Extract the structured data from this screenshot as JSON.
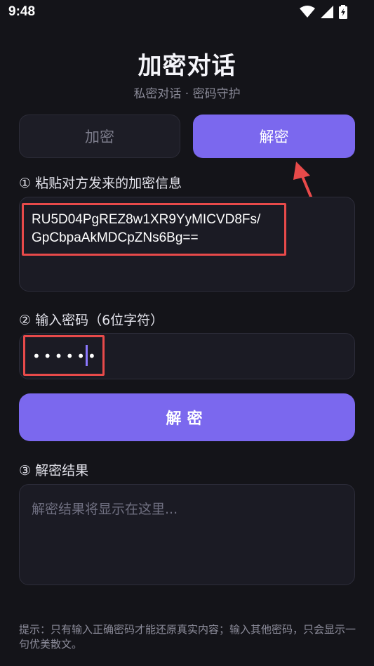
{
  "status_bar": {
    "time": "9:48",
    "icons": [
      "wifi-icon",
      "signal-icon",
      "battery-charging-icon"
    ]
  },
  "header": {
    "title": "加密对话",
    "subtitle": "私密对话 · 密码守护"
  },
  "tabs": [
    {
      "label": "加密",
      "active": false
    },
    {
      "label": "解密",
      "active": true
    }
  ],
  "step1": {
    "label": "① 粘贴对方发来的加密信息",
    "value_line1": "RU5D04PgREZ8w1XR9YyMICVD8Fs/",
    "value_line2": "GpCbpaAkMDCpZNs6Bg=="
  },
  "step2": {
    "label": "② 输入密码（6位字符）",
    "value": "••••••"
  },
  "decrypt_button": {
    "label": "解密"
  },
  "step3": {
    "label": "③ 解密结果",
    "placeholder": "解密结果将显示在这里..."
  },
  "hint": {
    "text": "提示：只有输入正确密码才能还原真实内容；输入其他密码，只会显示一句优美散文。"
  },
  "colors": {
    "accent": "#7b68ee",
    "background": "#141419",
    "annotation": "#e84a4a"
  }
}
